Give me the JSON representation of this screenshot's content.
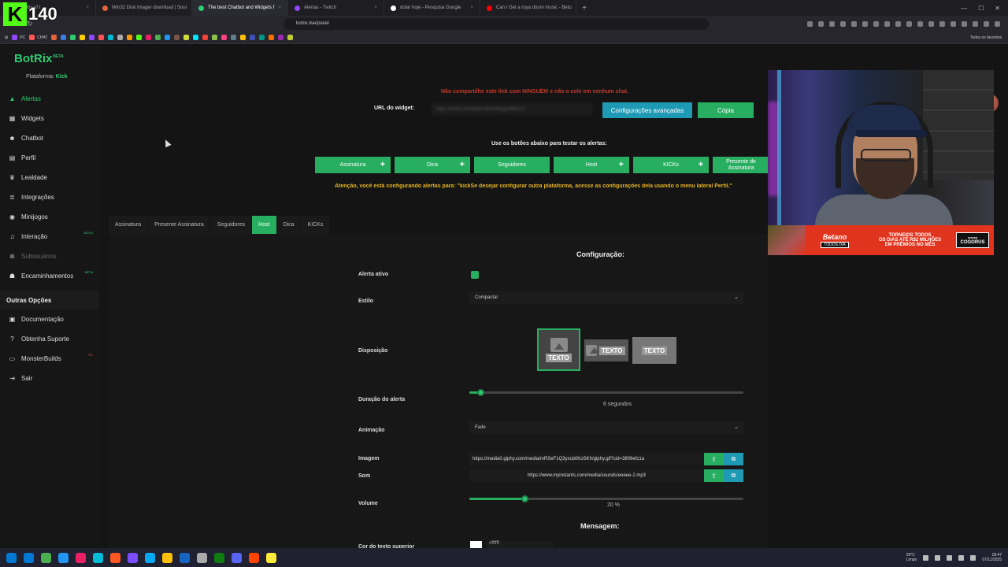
{
  "browser": {
    "tabs": [
      {
        "label": "...hobby of I",
        "active": false,
        "fav": "#3a7be4"
      },
      {
        "label": "Win32 Disk Imager download | Sour",
        "active": false,
        "fav": "#e4643a"
      },
      {
        "label": "The best Chatbot and Widgets f",
        "active": true,
        "fav": "#2ecc71"
      },
      {
        "label": "Alertas - Twitch",
        "active": false,
        "fav": "#9146ff"
      },
      {
        "label": "dolar hoje - Pesquisa Google",
        "active": false,
        "fav": "#ffffff"
      },
      {
        "label": "Can I Get a roya doom music - Beto",
        "active": false,
        "fav": "#ff0000"
      }
    ],
    "new_tab": "+",
    "url": "botrix.live/panel",
    "bookmarks": [
      {
        "label": "PC",
        "color": "#9146ff"
      },
      {
        "label": "CHAT",
        "color": "#ff5555"
      }
    ],
    "bookmark_icon_colors": [
      "#e4643a",
      "#3a7be4",
      "#2ecc71",
      "#ffcc00",
      "#9146ff",
      "#ff5555",
      "#00bcd4",
      "#aaaaaa",
      "#ff9800",
      "#53fc18",
      "#e91e63",
      "#4caf50",
      "#2196f3",
      "#795548",
      "#cddc39",
      "#00e5ff",
      "#f44336",
      "#8bc34a",
      "#ff4081",
      "#607d8b",
      "#ffc107",
      "#3f51b5",
      "#009688",
      "#ff6f00",
      "#9c27b0",
      "#c0ca33"
    ],
    "bookmarks_right": "Todos os favoritos"
  },
  "overlay": {
    "channel_number": "140",
    "kick_letter": "K"
  },
  "sidebar": {
    "logo": "BotRix",
    "logo_badge": "BETA",
    "platform_label": "Plataforma:",
    "platform_value": "Kick",
    "items": [
      {
        "label": "Alertas",
        "icon": "alert-triangle-icon",
        "glyph": "▲",
        "active": true
      },
      {
        "label": "Widgets",
        "icon": "grid-icon",
        "glyph": "▦"
      },
      {
        "label": "Chatbot",
        "icon": "robot-icon",
        "glyph": "☻"
      },
      {
        "label": "Perfil",
        "icon": "user-card-icon",
        "glyph": "▤"
      },
      {
        "label": "Lealdade",
        "icon": "trophy-icon",
        "glyph": "♛"
      },
      {
        "label": "Integrações",
        "icon": "list-icon",
        "glyph": "≣"
      },
      {
        "label": "Minijogos",
        "icon": "gamepad-icon",
        "glyph": "◉"
      },
      {
        "label": "Interação",
        "icon": "music-icon",
        "glyph": "♫",
        "badge": "NOVO"
      },
      {
        "label": "Subusuários",
        "icon": "users-icon",
        "glyph": "☗",
        "dim": true
      },
      {
        "label": "Encaminhamentos",
        "icon": "people-icon",
        "glyph": "☗",
        "badge": "BETA"
      }
    ],
    "section_title": "Outras Opções",
    "other_items": [
      {
        "label": "Documentação",
        "icon": "book-icon",
        "glyph": "▣"
      },
      {
        "label": "Obtenha Suporte",
        "icon": "help-icon",
        "glyph": "?"
      },
      {
        "label": "MonsterBuilds",
        "icon": "laptop-icon",
        "glyph": "▭",
        "badge": "PC",
        "badge_red": true
      },
      {
        "label": "Sair",
        "icon": "logout-icon",
        "glyph": "⇥"
      }
    ]
  },
  "widget": {
    "warning": "Não compartilhe este link com NINGUÉM e não o cole em nenhum chat.",
    "url_label": "URL do widget:",
    "url_value": "https://botrix.live/alerts?bid=RaxyzNMN1S",
    "advanced_button": "Configurações avançadas",
    "copy_button": "Cópia"
  },
  "test": {
    "label": "Use os botões abaixo para testar os alertas:",
    "buttons": [
      {
        "label": "Assinatura",
        "plus": true
      },
      {
        "label": "Dica",
        "plus": true
      },
      {
        "label": "Seguidores",
        "plus": false
      },
      {
        "label": "Host",
        "plus": true
      },
      {
        "label": "KICKs",
        "plus": true
      }
    ],
    "last_button": "Presente de Assinatura",
    "attention": "Atenção, você está configurando alertas para: \"kickSe desejar configurar outra plataforma, acesse as configurações dela usando o menu lateral Perfil.\""
  },
  "tabs": [
    {
      "label": "Assinatura",
      "active": false
    },
    {
      "label": "Presente Assinatura",
      "active": false
    },
    {
      "label": "Seguidores",
      "active": false
    },
    {
      "label": "Host",
      "active": true
    },
    {
      "label": "Dica",
      "active": false
    },
    {
      "label": "KICKs",
      "active": false
    }
  ],
  "config": {
    "title": "Configuração:",
    "active_label": "Alerta ativo",
    "active_value": true,
    "style_label": "Estilo",
    "style_value": "Compactar",
    "layout_label": "Disposição",
    "layout_text": "TEXTO",
    "duration_label": "Duração do alerta",
    "duration_fraction": 0.04,
    "duration_text": "6 segundos",
    "animation_label": "Animação",
    "animation_value": "Fade",
    "image_label": "Imagem",
    "image_value": "https://media0.giphy.com/media/mRSeF1Q3yxcb0KoSKh/giphy.gif?cid=3809efc1a",
    "sound_label": "Som",
    "sound_value": "https://www.myinstants.com/media/sounds/eeeee-2.mp3",
    "volume_label": "Volume",
    "volume_fraction": 0.2,
    "volume_text": "20 %",
    "message_title": "Mensagem:",
    "text_color_label": "Cor do texto superior",
    "text_color_value": "#ffffff"
  },
  "banner": {
    "brand": "Betano",
    "brand_tag": "TODOS DIA",
    "text_lines": [
      "TORNEIOS TODOS",
      "OS DIAS ATÉ R$2 MILHÕES",
      "EM PRÊMIOS NO MÊS"
    ],
    "logo_line1": "COGORUS",
    "logo_line2": "SERVER"
  },
  "taskbar": {
    "icon_colors": [
      "#0078d4",
      "#4caf50",
      "#2196f3",
      "#e91e63",
      "#00bcd4",
      "#ff5722",
      "#7c4dff",
      "#03a9f4",
      "#ffc107",
      "#1565c0",
      "#aaaaaa",
      "#107c10",
      "#5865f2",
      "#ff4500",
      "#ffeb3b"
    ],
    "weather_temp": "29°C",
    "weather_desc": "Limpo",
    "time": "18:47",
    "date": "07/11/2025"
  }
}
